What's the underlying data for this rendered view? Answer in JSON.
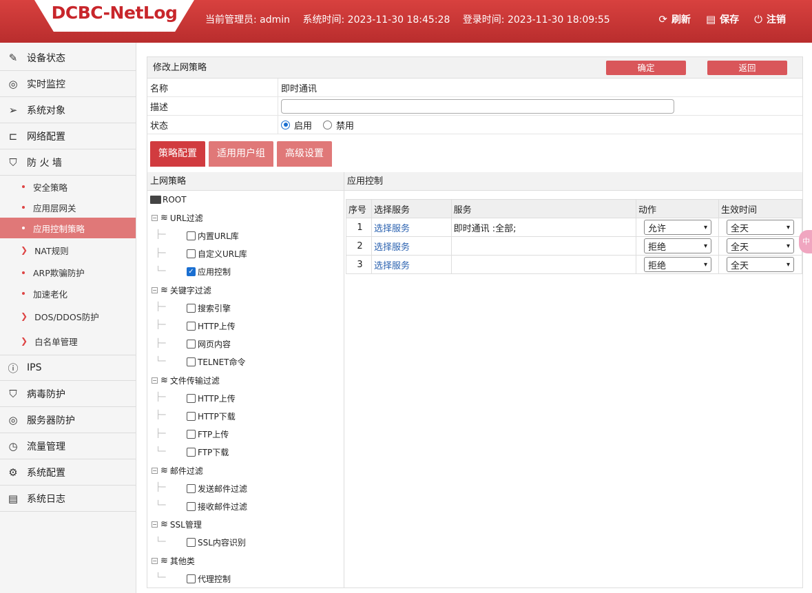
{
  "header": {
    "logo": "DCBC-NetLog",
    "admin": "当前管理员: admin",
    "system_time": "系统时间: 2023-11-30 18:45:28",
    "login_time": "登录时间: 2023-11-30 18:09:55",
    "refresh": "刷新",
    "save": "保存",
    "logout": "注销"
  },
  "sidebar": {
    "items": [
      {
        "label": "设备状态"
      },
      {
        "label": "实时监控"
      },
      {
        "label": "系统对象"
      },
      {
        "label": "网络配置"
      },
      {
        "label": "防 火 墙"
      }
    ],
    "subitems": [
      "安全策略",
      "应用层网关",
      "应用控制策略",
      "NAT规则",
      "ARP欺骗防护",
      "加速老化",
      "DOS/DDOS防护",
      "白名单管理"
    ],
    "items2": [
      "IPS",
      "病毒防护",
      "服务器防护",
      "流量管理",
      "系统配置",
      "系统日志"
    ]
  },
  "page": {
    "title": "修改上网策略",
    "confirm": "确定",
    "back": "返回",
    "name_label": "名称",
    "name_value": "即时通讯",
    "desc_label": "描述",
    "status_label": "状态",
    "enable": "启用",
    "disable": "禁用"
  },
  "tabs": [
    "策略配置",
    "适用用户组",
    "高级设置"
  ],
  "left_panel": {
    "title": "上网策略",
    "root": "ROOT",
    "groups": [
      {
        "name": "URL过滤",
        "children": [
          {
            "name": "内置URL库",
            "checked": false
          },
          {
            "name": "自定义URL库",
            "checked": false
          },
          {
            "name": "应用控制",
            "checked": true
          }
        ]
      },
      {
        "name": "关键字过滤",
        "children": [
          {
            "name": "搜索引擎",
            "checked": false
          },
          {
            "name": "HTTP上传",
            "checked": false
          },
          {
            "name": "网页内容",
            "checked": false
          },
          {
            "name": "TELNET命令",
            "checked": false
          }
        ]
      },
      {
        "name": "文件传输过滤",
        "children": [
          {
            "name": "HTTP上传",
            "checked": false
          },
          {
            "name": "HTTP下载",
            "checked": false
          },
          {
            "name": "FTP上传",
            "checked": false
          },
          {
            "name": "FTP下载",
            "checked": false
          }
        ]
      },
      {
        "name": "邮件过滤",
        "children": [
          {
            "name": "发送邮件过滤",
            "checked": false
          },
          {
            "name": "接收邮件过滤",
            "checked": false
          }
        ]
      },
      {
        "name": "SSL管理",
        "children": [
          {
            "name": "SSL内容识别",
            "checked": false
          }
        ]
      },
      {
        "name": "其他类",
        "children": [
          {
            "name": "代理控制",
            "checked": false
          }
        ]
      }
    ]
  },
  "right_panel": {
    "title": "应用控制",
    "columns": [
      "序号",
      "选择服务",
      "服务",
      "动作",
      "生效时间"
    ],
    "rows": [
      {
        "no": "1",
        "select": "选择服务",
        "service": "即时通讯 :全部;",
        "action": "允许",
        "time": "全天"
      },
      {
        "no": "2",
        "select": "选择服务",
        "service": "",
        "action": "拒绝",
        "time": "全天"
      },
      {
        "no": "3",
        "select": "选择服务",
        "service": "",
        "action": "拒绝",
        "time": "全天"
      }
    ]
  },
  "side_pill": "中"
}
